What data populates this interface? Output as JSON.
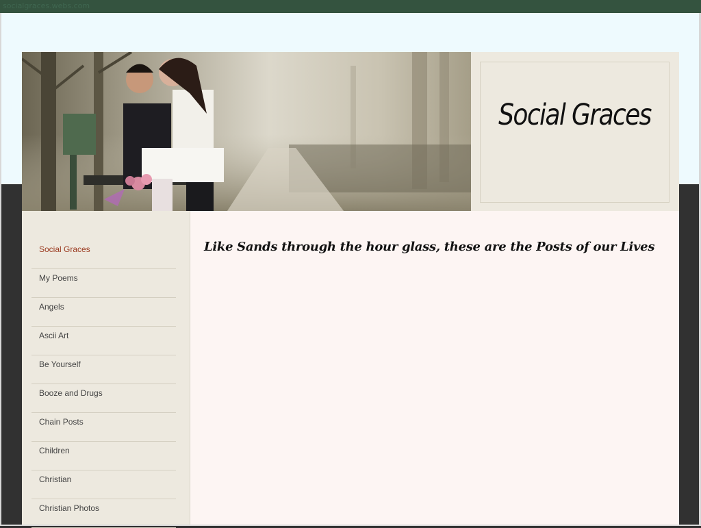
{
  "browser": {
    "status_text": "socialgraces.webs.com"
  },
  "site": {
    "logo_text": "Social Graces",
    "banner_alt": "couple-kissing-on-bench-in-fog"
  },
  "nav": {
    "items": [
      {
        "label": "Social Graces",
        "active": true
      },
      {
        "label": "My Poems"
      },
      {
        "label": "Angels"
      },
      {
        "label": "Ascii Art"
      },
      {
        "label": "Be Yourself"
      },
      {
        "label": "Booze and Drugs"
      },
      {
        "label": "Chain Posts"
      },
      {
        "label": "Children"
      },
      {
        "label": "Christian"
      },
      {
        "label": "Christian Photos"
      }
    ]
  },
  "main": {
    "heading": "Like Sands through the hour glass, these are the Posts of our Lives"
  },
  "colors": {
    "topbar": "#34533f",
    "sky": "#eefafe",
    "outer": "#313131",
    "sidebar": "#ede9df",
    "content": "#fdf5f3",
    "active_link": "#9b3b21"
  }
}
